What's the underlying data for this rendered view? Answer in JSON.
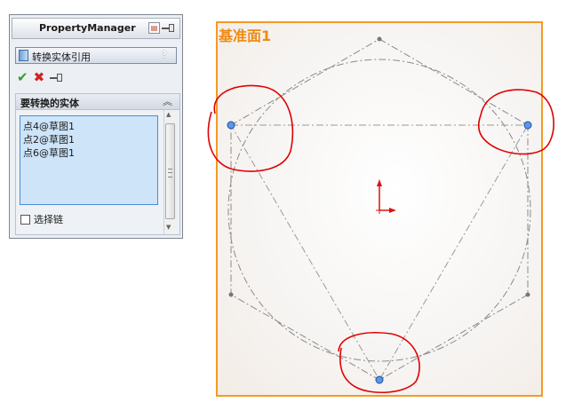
{
  "property_manager": {
    "title": "PropertyManager",
    "feature_name": "转换实体引用",
    "help_label": "?",
    "section_title": "要转换的实体",
    "entities": [
      "点4@草图1",
      "点2@草图1",
      "点6@草图1"
    ],
    "select_chain_label": "选择链",
    "select_chain_checked": false
  },
  "graphics": {
    "plane_label": "基准面1",
    "plane_color": "#f59a23",
    "point_color": "#4a86e8",
    "markup_color": "#e00000"
  }
}
